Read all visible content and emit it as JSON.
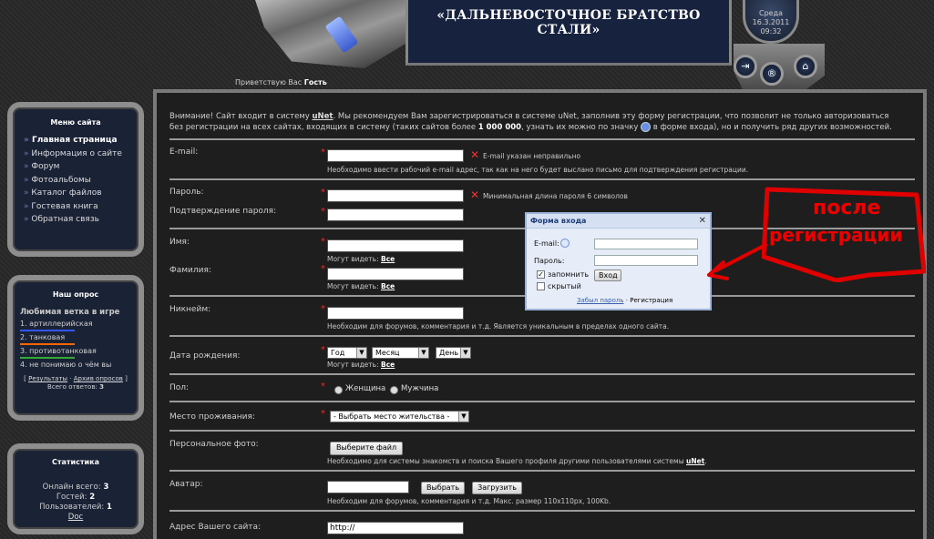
{
  "header": {
    "site_title": "«ДАЛЬНЕВОСТОЧНОЕ БРАТСТВО СТАЛИ»",
    "clock_day": "Среда",
    "clock_date": "16.3.2011",
    "clock_time": "09:32",
    "greeting_prefix": "Приветствую Вас",
    "greeting_name": "Гость",
    "buttons": [
      {
        "name": "login-icon",
        "glyph": "⇥"
      },
      {
        "name": "register-icon",
        "glyph": "®"
      },
      {
        "name": "home-icon",
        "glyph": "⌂"
      }
    ]
  },
  "sidebar": {
    "menu_title": "Меню сайта",
    "menu_items": [
      {
        "label": "Главная страница",
        "active": true
      },
      {
        "label": "Информация о сайте"
      },
      {
        "label": "Форум"
      },
      {
        "label": "Фотоальбомы"
      },
      {
        "label": "Каталог файлов"
      },
      {
        "label": "Гостевая книга"
      },
      {
        "label": "Обратная связь"
      }
    ],
    "poll": {
      "title": "Наш опрос",
      "question": "Любимая ветка в игре",
      "options": [
        {
          "label": "1. артиллерийская",
          "color": "#3355ff",
          "fraction": 0.6
        },
        {
          "label": "2. танковая",
          "color": "#ff6600",
          "fraction": 0.6
        },
        {
          "label": "3. противотанковая",
          "color": "#33aa33",
          "fraction": 0.6
        },
        {
          "label": "4. не понимаю о чём вы",
          "color": "#dddddd",
          "fraction": 0
        }
      ],
      "results_link": "Результаты",
      "archive_link": "Архив опросов",
      "total_label": "Всего ответов:",
      "total_value": "3"
    },
    "stats": {
      "title": "Статистика",
      "online_label": "Онлайн всего:",
      "online_value": "3",
      "guests_label": "Гостей:",
      "guests_value": "2",
      "users_label": "Пользователей:",
      "users_value": "1",
      "user_name": "Doc"
    }
  },
  "form": {
    "notice": {
      "part1": "Внимание! Сайт входит в систему ",
      "unet": "uNet",
      "part2": ". Мы рекомендуем Вам зарегистрироваться в системе uNet, заполнив эту форму регистрации, что позволит не только авторизоваться без регистрации на всех сайтах, входящих в систему (таких сайтов более ",
      "count": "1 000 000",
      "part3": ", узнать их можно по значку ",
      "part4": " в форме входа), но и получить ряд других возможностей."
    },
    "email_label": "E-mail:",
    "email_error": "E-mail указан неправильно",
    "email_hint": "Необходимо ввести рабочий e-mail адрес, так как на него будет выслано письмо для подтверждения регистрации.",
    "password_label": "Пароль:",
    "password_error": "Минимальная длина пароля 6 символов",
    "confirm_label": "Подтверждение пароля:",
    "name_label": "Имя:",
    "visible_prefix": "Могут видеть:",
    "visible_value": "Все",
    "surname_label": "Фамилия:",
    "nick_label": "Никнейм:",
    "nick_hint": "Необходим для форумов, комментария и т.д. Является уникальным в пределах одного сайта.",
    "birth_label": "Дата рождения:",
    "birth_year": "Год",
    "birth_month": "Месяц",
    "birth_day": "День",
    "gender_label": "Пол:",
    "gender_female": "Женщина",
    "gender_male": "Мужчина",
    "residence_label": "Место проживания:",
    "residence_value": "- Выбрать место жительства -",
    "photo_label": "Персональное фото:",
    "photo_button": "Выберите файл",
    "photo_hint_a": "Необходимо для системы знакомств и поиска Вашего профиля другими пользователями системы ",
    "photo_hint_b": "uNet",
    "photo_hint_c": ".",
    "avatar_label": "Аватар:",
    "avatar_choose": "Выбрать",
    "avatar_upload": "Загрузить",
    "avatar_hint": "Необходим для форумов, комментария и т.д. Макс. размер 110x110px, 100Kb.",
    "website_label": "Адрес Вашего сайта:",
    "website_value": "http://"
  },
  "login_popup": {
    "title": "Форма входа",
    "email_label": "E-mail:",
    "password_label": "Пароль:",
    "remember_label": "запомнить",
    "hidden_label": "скрытый",
    "submit_label": "Вход",
    "forgot_link": "Забыл пароль",
    "separator": "·",
    "register_link": "Регистрация",
    "remember_checked": true
  },
  "annotation": {
    "line1": "после",
    "line2": "регистрации",
    "color": "#e00000"
  }
}
